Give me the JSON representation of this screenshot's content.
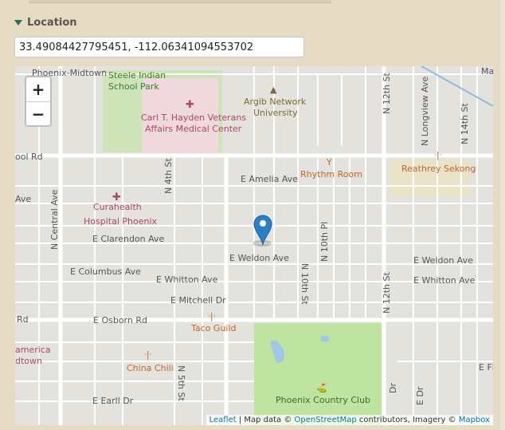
{
  "section": {
    "title": "Location"
  },
  "coordinates": {
    "value": "33.49084427795451, -112.06341094553702"
  },
  "map": {
    "zoom_in": "+",
    "zoom_out": "−",
    "marker_icon": "map-pin-icon",
    "streets": {
      "phoenix_midtown": "Phoenix-Midtown",
      "steele_park_1": "Steele Indian",
      "steele_park_2": "School Park",
      "va_1": "Carl T. Hayden Veterans",
      "va_2": "Affairs Medical Center",
      "argib_1": "Argib Network",
      "argib_2": "University",
      "n12th_top": "N 12th St",
      "longview": "N Longview Ave",
      "n14th": "N 14th St",
      "ma": "Ma",
      "pool_rd": "ool Rd",
      "rhythm": "Rhythm Room",
      "reathrey": "Reathrey Sekong",
      "amelia": "E Amelia Ave",
      "ave_left": "Ave",
      "n_central": "N Central Ave",
      "n4th": "N 4th St",
      "curahealth_1": "Curahealth",
      "curahealth_2": "Hospital Phoenix",
      "clarendon": "E Clarendon Ave",
      "n10th": "N 10th St",
      "n10th_pl": "N 10th Pl",
      "weldon": "E Weldon Ave",
      "weldon_right": "E Weldon Ave",
      "columbus": "E Columbus Ave",
      "whitton": "E Whitton Ave",
      "whitton_right": "E Whitton Ave",
      "n12th_bottom": "N 12th St",
      "mitchell": "E Mitchell Dr",
      "rd_left": "Rd",
      "osborn": "E Osborn Rd",
      "taco": "Taco Guild",
      "america_1": "america",
      "america_2": "dtown",
      "china": "China Chili",
      "n5th": "N 5th St",
      "phx_cc": "Phoenix Country Club",
      "earll": "E Earll Dr",
      "e_fl": "E Fl",
      "dr_1": "Dr",
      "e_dr": "E Dr"
    },
    "attribution": {
      "leaflet": "Leaflet",
      "sep1": " | Map data © ",
      "osm": "OpenStreetMap",
      "mid": " contributors, Imagery © ",
      "mapbox": "Mapbox"
    }
  }
}
